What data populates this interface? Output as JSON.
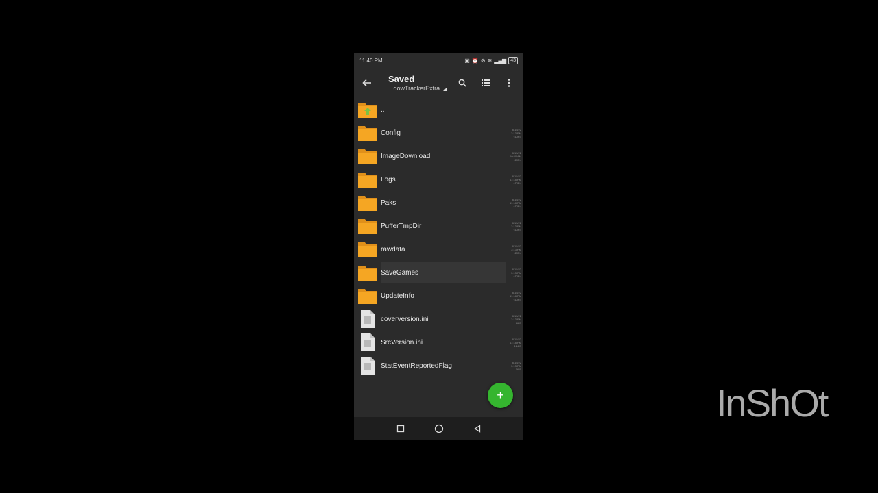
{
  "status_bar": {
    "time": "11:40 PM",
    "battery": "43"
  },
  "app_bar": {
    "title": "Saved",
    "subtitle": "...dowTrackerExtra"
  },
  "files": [
    {
      "name": "..",
      "type": "parent",
      "meta": [
        "",
        "",
        ""
      ]
    },
    {
      "name": "Config",
      "type": "folder",
      "meta": [
        "8/15/22",
        "3:13 PM",
        "<DIR>"
      ]
    },
    {
      "name": "ImageDownload",
      "type": "folder",
      "meta": [
        "8/15/22",
        "10:50 AM",
        "<DIR>"
      ]
    },
    {
      "name": "Logs",
      "type": "folder",
      "meta": [
        "8/15/22",
        "11:18 PM",
        "<DIR>"
      ]
    },
    {
      "name": "Paks",
      "type": "folder",
      "meta": [
        "8/15/22",
        "11:18 PM",
        "<DIR>"
      ]
    },
    {
      "name": "PufferTmpDir",
      "type": "folder",
      "meta": [
        "8/15/22",
        "3:13 PM",
        "<DIR>"
      ]
    },
    {
      "name": "rawdata",
      "type": "folder",
      "meta": [
        "8/15/22",
        "3:13 PM",
        "<DIR>"
      ]
    },
    {
      "name": "SaveGames",
      "type": "folder",
      "meta": [
        "8/15/22",
        "3:13 PM",
        "<DIR>"
      ]
    },
    {
      "name": "UpdateInfo",
      "type": "folder",
      "meta": [
        "8/15/22",
        "11:18 PM",
        "<DIR>"
      ]
    },
    {
      "name": "coverversion.ini",
      "type": "file",
      "meta": [
        "8/15/22",
        "3:13 PM",
        "66 B"
      ]
    },
    {
      "name": "SrcVersion.ini",
      "type": "file",
      "meta": [
        "8/15/22",
        "11:18 PM",
        "124 B"
      ]
    },
    {
      "name": "StatEventReportedFlag",
      "type": "file",
      "meta": [
        "8/15/22",
        "3:13 PM",
        "16 B"
      ]
    }
  ],
  "fab": {
    "label": "+"
  },
  "watermark": "InShOt",
  "colors": {
    "folder": "#f5a623",
    "fab": "#35b52f",
    "background": "#2b2b2b"
  }
}
